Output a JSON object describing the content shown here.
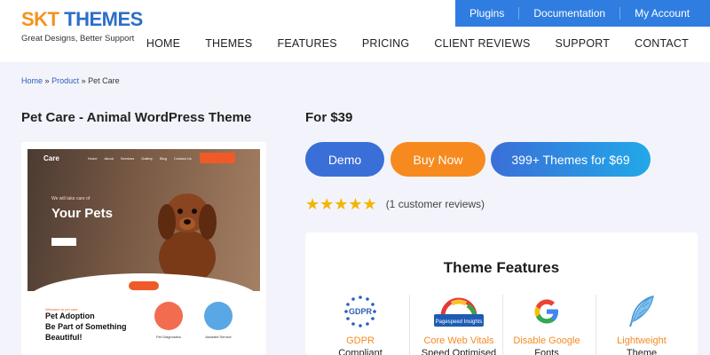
{
  "brand": {
    "skt": "SKT",
    "themes": "THEMES",
    "tagline": "Great Designs, Better Support"
  },
  "topbar": {
    "items": [
      "Plugins",
      "Documentation",
      "My Account"
    ]
  },
  "nav": {
    "items": [
      "HOME",
      "THEMES",
      "FEATURES",
      "PRICING",
      "CLIENT REVIEWS",
      "SUPPORT",
      "CONTACT"
    ]
  },
  "breadcrumb": {
    "home": "Home",
    "sep": "»",
    "product": "Product",
    "current": "Pet Care"
  },
  "product": {
    "title": "Pet Care - Animal WordPress Theme",
    "price": "For $39"
  },
  "buttons": {
    "demo": "Demo",
    "buy": "Buy Now",
    "bundle": "399+ Themes for $69"
  },
  "rating": {
    "stars": "★★★★★",
    "reviews": "(1 customer reviews)"
  },
  "preview": {
    "logo": "Care",
    "links": [
      "Home",
      "About",
      "Services",
      "Gallery",
      "Blog",
      "Contact Us"
    ],
    "hero_small": "We will take care of",
    "hero_big": "Your Pets",
    "adopt_small": "Welcome to pet care",
    "adopt_line1": "Pet Adoption",
    "adopt_line2": "Be Part of Something",
    "adopt_line3": "Beautiful!",
    "cap1": "Pet Diagnostics",
    "cap2": "Assisted Service"
  },
  "features": {
    "heading": "Theme Features",
    "items": [
      {
        "label": "GDPR",
        "sub": "Compliant",
        "icon": "gdpr-icon"
      },
      {
        "label": "Core Web Vitals",
        "sub": "Speed Optimised",
        "icon": "pagespeed-icon"
      },
      {
        "label": "Disable Google",
        "sub": "Fonts",
        "icon": "google-icon"
      },
      {
        "label": "Lightweight",
        "sub": "Theme",
        "icon": "feather-icon"
      }
    ]
  },
  "colors": {
    "accent": "#2f7de1",
    "orange": "#f68a1f",
    "star": "#f4b400"
  }
}
